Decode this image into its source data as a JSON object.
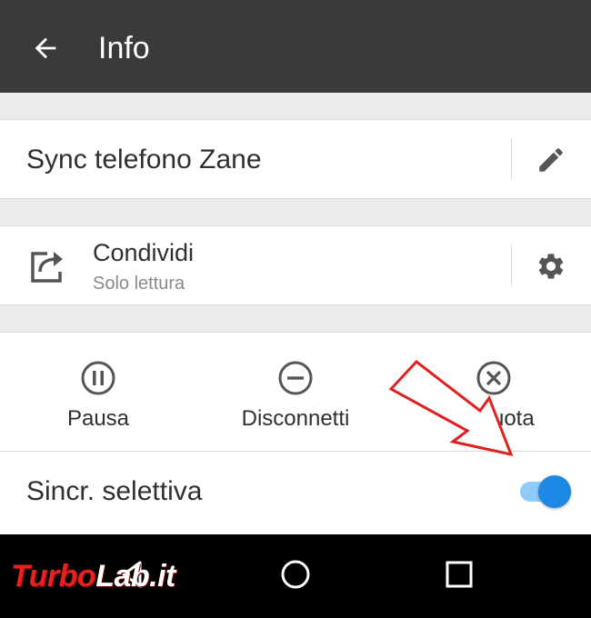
{
  "colors": {
    "appbar": "#3a3a3a",
    "toggle_thumb": "#1e88e5",
    "toggle_track": "#90caf9",
    "annotation": "#e02020",
    "watermark_red": "#e32222"
  },
  "appbar": {
    "title": "Info",
    "back_icon": "arrow-left-icon"
  },
  "folder": {
    "name": "Sync telefono Zane",
    "edit_icon": "pencil-icon"
  },
  "share": {
    "title": "Condividi",
    "subtitle": "Solo lettura",
    "icon": "share-icon",
    "settings_icon": "gear-icon"
  },
  "actions": [
    {
      "label": "Pausa",
      "icon": "pause-circle-icon"
    },
    {
      "label": "Disconnetti",
      "icon": "minus-circle-icon"
    },
    {
      "label": "Rimuota",
      "icon": "close-circle-icon"
    }
  ],
  "selective_sync": {
    "label": "Sincr. selettiva",
    "enabled": true
  },
  "navbar": {
    "back_icon": "triangle-back-icon",
    "home_icon": "circle-home-icon",
    "recents_icon": "square-recents-icon"
  },
  "watermark": {
    "part1": "Turbo",
    "part2": "Lab.it"
  }
}
